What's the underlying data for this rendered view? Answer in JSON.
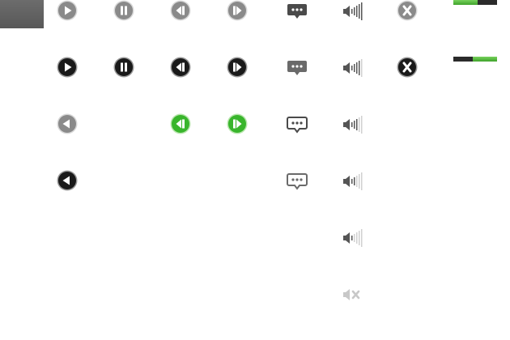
{
  "sprite": {
    "colors": {
      "light_gray": "#8a8a8a",
      "dark": "#1a1a1a",
      "green": "#39b52c",
      "bubble_dark": "#4a4a4a",
      "bubble_mid": "#6a6a6a",
      "bubble_light": "#909090",
      "volume": "#555555",
      "volume_faint": "#d0d0d0"
    },
    "icons": {
      "play": "play-icon",
      "pause": "pause-icon",
      "previous": "previous-icon",
      "next": "next-icon",
      "close": "close-icon",
      "back": "back-icon",
      "speech_bubble": "speech-bubble-icon",
      "volume": "volume-icon",
      "mute": "mute-icon"
    },
    "volume_levels": [
      5,
      4,
      3,
      2,
      1,
      0
    ],
    "progress_bars": [
      0.55,
      0.55
    ]
  }
}
